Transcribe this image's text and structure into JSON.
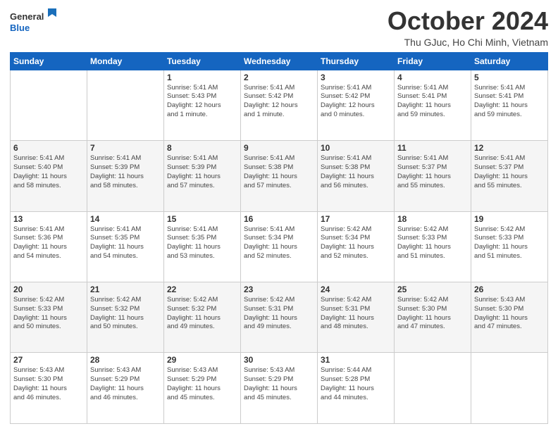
{
  "header": {
    "logo_line1": "General",
    "logo_line2": "Blue",
    "month_title": "October 2024",
    "subtitle": "Thu GJuc, Ho Chi Minh, Vietnam"
  },
  "days_of_week": [
    "Sunday",
    "Monday",
    "Tuesday",
    "Wednesday",
    "Thursday",
    "Friday",
    "Saturday"
  ],
  "weeks": [
    [
      {
        "day": "",
        "info": ""
      },
      {
        "day": "",
        "info": ""
      },
      {
        "day": "1",
        "info": "Sunrise: 5:41 AM\nSunset: 5:43 PM\nDaylight: 12 hours\nand 1 minute."
      },
      {
        "day": "2",
        "info": "Sunrise: 5:41 AM\nSunset: 5:42 PM\nDaylight: 12 hours\nand 1 minute."
      },
      {
        "day": "3",
        "info": "Sunrise: 5:41 AM\nSunset: 5:42 PM\nDaylight: 12 hours\nand 0 minutes."
      },
      {
        "day": "4",
        "info": "Sunrise: 5:41 AM\nSunset: 5:41 PM\nDaylight: 11 hours\nand 59 minutes."
      },
      {
        "day": "5",
        "info": "Sunrise: 5:41 AM\nSunset: 5:41 PM\nDaylight: 11 hours\nand 59 minutes."
      }
    ],
    [
      {
        "day": "6",
        "info": "Sunrise: 5:41 AM\nSunset: 5:40 PM\nDaylight: 11 hours\nand 58 minutes."
      },
      {
        "day": "7",
        "info": "Sunrise: 5:41 AM\nSunset: 5:39 PM\nDaylight: 11 hours\nand 58 minutes."
      },
      {
        "day": "8",
        "info": "Sunrise: 5:41 AM\nSunset: 5:39 PM\nDaylight: 11 hours\nand 57 minutes."
      },
      {
        "day": "9",
        "info": "Sunrise: 5:41 AM\nSunset: 5:38 PM\nDaylight: 11 hours\nand 57 minutes."
      },
      {
        "day": "10",
        "info": "Sunrise: 5:41 AM\nSunset: 5:38 PM\nDaylight: 11 hours\nand 56 minutes."
      },
      {
        "day": "11",
        "info": "Sunrise: 5:41 AM\nSunset: 5:37 PM\nDaylight: 11 hours\nand 55 minutes."
      },
      {
        "day": "12",
        "info": "Sunrise: 5:41 AM\nSunset: 5:37 PM\nDaylight: 11 hours\nand 55 minutes."
      }
    ],
    [
      {
        "day": "13",
        "info": "Sunrise: 5:41 AM\nSunset: 5:36 PM\nDaylight: 11 hours\nand 54 minutes."
      },
      {
        "day": "14",
        "info": "Sunrise: 5:41 AM\nSunset: 5:35 PM\nDaylight: 11 hours\nand 54 minutes."
      },
      {
        "day": "15",
        "info": "Sunrise: 5:41 AM\nSunset: 5:35 PM\nDaylight: 11 hours\nand 53 minutes."
      },
      {
        "day": "16",
        "info": "Sunrise: 5:41 AM\nSunset: 5:34 PM\nDaylight: 11 hours\nand 52 minutes."
      },
      {
        "day": "17",
        "info": "Sunrise: 5:42 AM\nSunset: 5:34 PM\nDaylight: 11 hours\nand 52 minutes."
      },
      {
        "day": "18",
        "info": "Sunrise: 5:42 AM\nSunset: 5:33 PM\nDaylight: 11 hours\nand 51 minutes."
      },
      {
        "day": "19",
        "info": "Sunrise: 5:42 AM\nSunset: 5:33 PM\nDaylight: 11 hours\nand 51 minutes."
      }
    ],
    [
      {
        "day": "20",
        "info": "Sunrise: 5:42 AM\nSunset: 5:33 PM\nDaylight: 11 hours\nand 50 minutes."
      },
      {
        "day": "21",
        "info": "Sunrise: 5:42 AM\nSunset: 5:32 PM\nDaylight: 11 hours\nand 50 minutes."
      },
      {
        "day": "22",
        "info": "Sunrise: 5:42 AM\nSunset: 5:32 PM\nDaylight: 11 hours\nand 49 minutes."
      },
      {
        "day": "23",
        "info": "Sunrise: 5:42 AM\nSunset: 5:31 PM\nDaylight: 11 hours\nand 49 minutes."
      },
      {
        "day": "24",
        "info": "Sunrise: 5:42 AM\nSunset: 5:31 PM\nDaylight: 11 hours\nand 48 minutes."
      },
      {
        "day": "25",
        "info": "Sunrise: 5:42 AM\nSunset: 5:30 PM\nDaylight: 11 hours\nand 47 minutes."
      },
      {
        "day": "26",
        "info": "Sunrise: 5:43 AM\nSunset: 5:30 PM\nDaylight: 11 hours\nand 47 minutes."
      }
    ],
    [
      {
        "day": "27",
        "info": "Sunrise: 5:43 AM\nSunset: 5:30 PM\nDaylight: 11 hours\nand 46 minutes."
      },
      {
        "day": "28",
        "info": "Sunrise: 5:43 AM\nSunset: 5:29 PM\nDaylight: 11 hours\nand 46 minutes."
      },
      {
        "day": "29",
        "info": "Sunrise: 5:43 AM\nSunset: 5:29 PM\nDaylight: 11 hours\nand 45 minutes."
      },
      {
        "day": "30",
        "info": "Sunrise: 5:43 AM\nSunset: 5:29 PM\nDaylight: 11 hours\nand 45 minutes."
      },
      {
        "day": "31",
        "info": "Sunrise: 5:44 AM\nSunset: 5:28 PM\nDaylight: 11 hours\nand 44 minutes."
      },
      {
        "day": "",
        "info": ""
      },
      {
        "day": "",
        "info": ""
      }
    ]
  ]
}
